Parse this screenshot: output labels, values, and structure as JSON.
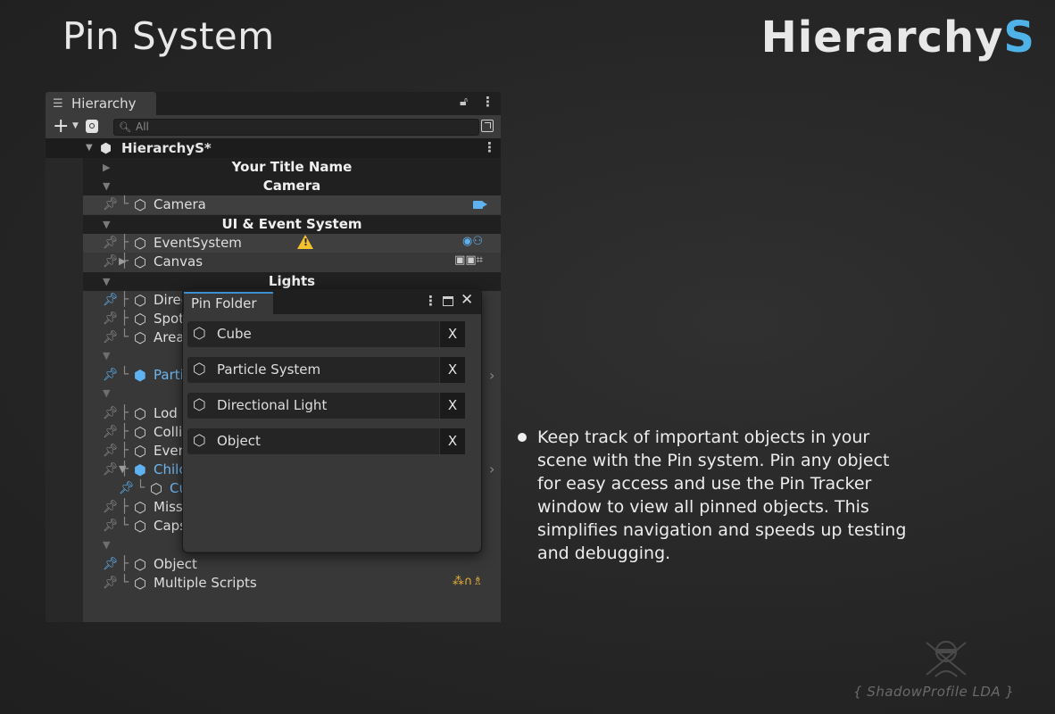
{
  "page": {
    "title": "Pin System",
    "brand_main": "Hierarchy",
    "brand_accent": "S",
    "accent_color": "#4fb3e8"
  },
  "hierarchy": {
    "tab_label": "Hierarchy",
    "tab_icon": "list-icon",
    "search_placeholder": "All",
    "scene_name": "HierarchyS*",
    "rows": {
      "title_header": "Your Title Name",
      "camera_header": "Camera",
      "camera": "Camera",
      "ui_header": "UI & Event System",
      "eventsystem": "EventSystem",
      "canvas": "Canvas",
      "lights_header": "Lights",
      "directional": "Direc",
      "spot": "Spot",
      "area": "Area",
      "particle": "Parti",
      "lod": "Lod",
      "collider": "Colli",
      "event": "Even",
      "child": "Chilc",
      "child_sub": "Cu",
      "missing": "Miss",
      "capsule": "Caps",
      "object": "Object",
      "multiple_scripts": "Multiple Scripts"
    }
  },
  "pin_window": {
    "tab_label": "Pin Folder",
    "close_symbol": "✕",
    "items": [
      {
        "label": "Cube",
        "remove": "X"
      },
      {
        "label": "Particle System",
        "remove": "X"
      },
      {
        "label": "Directional Light",
        "remove": "X"
      },
      {
        "label": "Object",
        "remove": "X"
      }
    ]
  },
  "description": "Keep track of important objects in your scene with the Pin system. Pin any object for easy access and use the Pin Tracker window to view all pinned objects. This simplifies navigation and speeds up testing and debugging.",
  "credit": "{ ShadowProfile LDA }"
}
